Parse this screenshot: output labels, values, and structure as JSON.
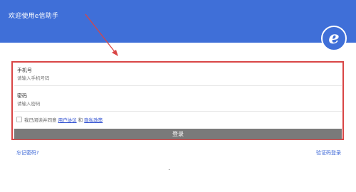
{
  "header": {
    "title": "欢迎使用e信助手",
    "logo_letter": "e",
    "background": "#3f6fd8"
  },
  "form": {
    "phone_label": "手机号",
    "phone_placeholder": "请输入手机号码",
    "password_label": "密码",
    "password_placeholder": "请输入密码",
    "agree_prefix": "我已阅读并同意",
    "user_agreement": "用户协议",
    "and_text": "和",
    "privacy_policy": "隐私政策",
    "login_label": "登录",
    "highlight_color": "#d94545"
  },
  "footer": {
    "forgot_password": "忘记密码?",
    "sms_login": "验证码登录",
    "link_color": "#3a66d6"
  }
}
